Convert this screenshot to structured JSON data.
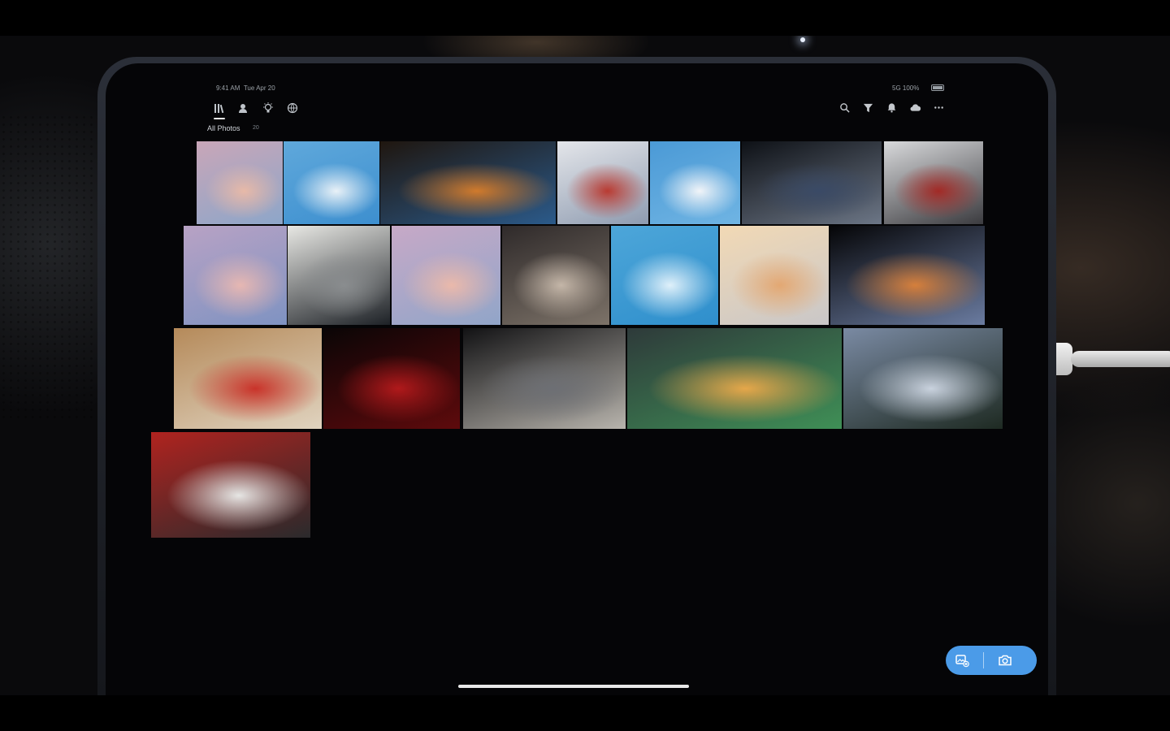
{
  "status_bar": {
    "time": "9:41 AM",
    "date": "Tue Apr 20",
    "right": "5G 100%"
  },
  "top_nav": {
    "tabs": [
      {
        "icon": "library-icon",
        "active": true
      },
      {
        "icon": "people-icon",
        "active": false
      },
      {
        "icon": "learn-lightbulb-icon",
        "active": false
      },
      {
        "icon": "discover-globe-icon",
        "active": false
      }
    ],
    "tools": [
      "search-icon",
      "filter-icon",
      "bell-icon",
      "cloud-sync-icon",
      "more-icon"
    ]
  },
  "album": {
    "title": "All Photos",
    "count": "20"
  },
  "photos": [
    {
      "subject": "pink clouds sky",
      "colors": [
        "#c9a6b8",
        "#e7b9a8",
        "#8da6c9"
      ]
    },
    {
      "subject": "cumulus cloud blue sky",
      "colors": [
        "#5fa8db",
        "#e9f1f7",
        "#3d8fcf"
      ]
    },
    {
      "subject": "orange muscle car under bridge at night",
      "colors": [
        "#1f160f",
        "#d07a2c",
        "#2b5a8a"
      ]
    },
    {
      "subject": "car burnout smoke",
      "colors": [
        "#e4e6ea",
        "#b93b32",
        "#8e9bb0"
      ]
    },
    {
      "subject": "cumulus cloud blue sky",
      "colors": [
        "#4b9ad6",
        "#f1f4f8",
        "#6fb4e3"
      ]
    },
    {
      "subject": "dark classic car side",
      "colors": [
        "#0e1116",
        "#3a4a66",
        "#6c7686"
      ]
    },
    {
      "subject": "red car burnout wheel",
      "colors": [
        "#d8d9db",
        "#a22a26",
        "#3b3b3f"
      ]
    },
    {
      "subject": "pink clouds sky",
      "colors": [
        "#b8a2c4",
        "#e6b7b2",
        "#7f93c2"
      ]
    },
    {
      "subject": "suv on road with light trails",
      "colors": [
        "#e8e8e4",
        "#8a8d8f",
        "#1d2126"
      ]
    },
    {
      "subject": "pink clouds sky",
      "colors": [
        "#c7a9c7",
        "#eab9ab",
        "#91a5c8"
      ]
    },
    {
      "subject": "classic car rear on lakebed",
      "colors": [
        "#2f2a2a",
        "#c4b6a8",
        "#7c7268"
      ]
    },
    {
      "subject": "small cloud blue sky",
      "colors": [
        "#4da6d9",
        "#dff0fa",
        "#2f8fcc"
      ]
    },
    {
      "subject": "sunset gradient sky",
      "colors": [
        "#f2d9b5",
        "#e3a873",
        "#c9c7c8"
      ]
    },
    {
      "subject": "car light streaks dark",
      "colors": [
        "#050507",
        "#d57f3c",
        "#6a7ba0"
      ]
    },
    {
      "subject": "red car dust cloud",
      "colors": [
        "#b58a5a",
        "#c9332a",
        "#e0d3bf"
      ]
    },
    {
      "subject": "red light trails night",
      "colors": [
        "#0a0506",
        "#b0191b",
        "#5e0a0c"
      ]
    },
    {
      "subject": "muscle car front smoke",
      "colors": [
        "#121214",
        "#6d6f74",
        "#b8b4ad"
      ]
    },
    {
      "subject": "motion blur car light trails",
      "colors": [
        "#2e3a3a",
        "#e5a74a",
        "#3f8f56"
      ]
    },
    {
      "subject": "green muscle car on lakebed",
      "colors": [
        "#7a8aa3",
        "#c9d2de",
        "#1e2a22"
      ]
    },
    {
      "subject": "red car burnout smoke",
      "colors": [
        "#b0231f",
        "#e6e6e4",
        "#2a2a2c"
      ]
    }
  ],
  "fab": {
    "left_icon": "add-photo-icon",
    "right_icon": "camera-icon",
    "color": "#4b9be8"
  }
}
